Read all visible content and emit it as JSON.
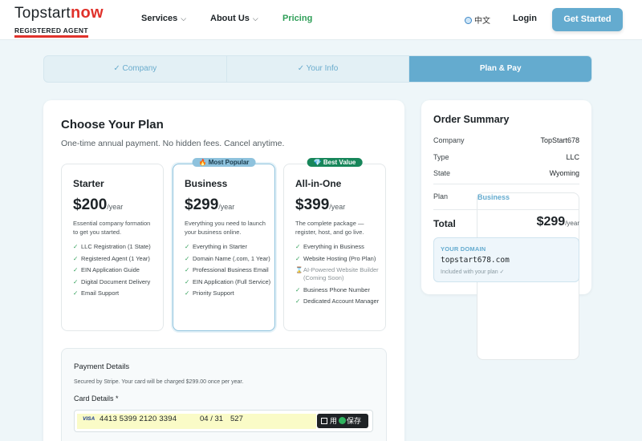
{
  "header": {
    "logo_main": "Topstart",
    "logo_accent": "now",
    "logo_sub": "REGISTERED AGENT",
    "nav": [
      "Services",
      "About Us",
      "Pricing"
    ],
    "lang": "中文",
    "login": "Login",
    "cta": "Get Started"
  },
  "steps": [
    {
      "label": "✓ Company"
    },
    {
      "label": "✓ Your Info"
    },
    {
      "label": "Plan & Pay"
    }
  ],
  "plan_section": {
    "title": "Choose Your Plan",
    "subtitle": "One-time annual payment. No hidden fees. Cancel anytime."
  },
  "plans": [
    {
      "name": "Starter",
      "price": "$200",
      "period": "/year",
      "desc": "Essential company formation to get you started.",
      "features": [
        "LLC Registration (1 State)",
        "Registered Agent (1 Year)",
        "EIN Application Guide",
        "Digital Document Delivery",
        "Email Support"
      ]
    },
    {
      "name": "Business",
      "badge": "🔥 Most Popular",
      "price": "$299",
      "period": "/year",
      "desc": "Everything you need to launch your business online.",
      "features": [
        "Everything in Starter",
        "Domain Name (.com, 1 Year)",
        "Professional Business Email",
        "EIN Application (Full Service)",
        "Priority Support"
      ]
    },
    {
      "name": "All-in-One",
      "badge": "💎 Best Value",
      "price": "$399",
      "period": "/year",
      "desc": "The complete package — register, host, and go live.",
      "features": [
        "Everything in Business",
        "Website Hosting (Pro Plan)",
        "AI-Powered Website Builder (Coming Soon)",
        "Business Phone Number",
        "Dedicated Account Manager"
      ]
    }
  ],
  "payment": {
    "title": "Payment Details",
    "subtitle": "Secured by Stripe. Your card will be charged $299.00 once per year.",
    "card_label": "Card Details *",
    "card_brand": "VISA",
    "card_number": "4413 5399 2120 3394",
    "card_exp": "04 / 31",
    "card_cvc": "527",
    "save_use": "用",
    "save_label": "保存"
  },
  "summary": {
    "title": "Order Summary",
    "rows": [
      {
        "label": "Company",
        "value": "TopStart678"
      },
      {
        "label": "Type",
        "value": "LLC"
      },
      {
        "label": "State",
        "value": "Wyoming"
      },
      {
        "label": "Plan",
        "value": "Business"
      }
    ],
    "total_label": "Total",
    "total_value": "$299",
    "total_period": "/year",
    "domain_label": "YOUR DOMAIN",
    "domain_value": "topstart678.com",
    "domain_note": "Included with your plan ✓"
  },
  "colors": {
    "accent": "#64abcf",
    "brand_red": "#e0322b",
    "green": "#2e9e57"
  },
  "icons": {
    "lang": "globe-icon",
    "chevron": "chevron-down-icon",
    "check": "check-icon",
    "hourglass": "hourglass-icon",
    "fire": "fire-icon",
    "gem": "gem-icon"
  }
}
